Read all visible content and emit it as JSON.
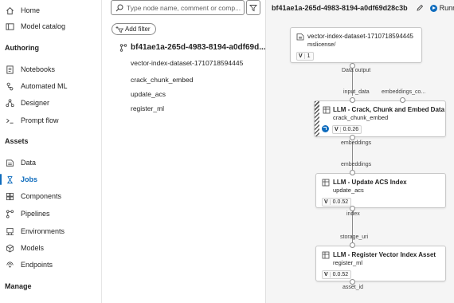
{
  "nav": {
    "items_top": [
      {
        "label": "Home",
        "icon": "home-icon"
      },
      {
        "label": "Model catalog",
        "icon": "model-catalog-icon"
      }
    ],
    "section_authoring": "Authoring",
    "items_authoring": [
      {
        "label": "Notebooks",
        "icon": "notebook-icon"
      },
      {
        "label": "Automated ML",
        "icon": "automated-ml-icon"
      },
      {
        "label": "Designer",
        "icon": "designer-icon"
      },
      {
        "label": "Prompt flow",
        "icon": "prompt-flow-icon"
      }
    ],
    "section_assets": "Assets",
    "items_assets": [
      {
        "label": "Data",
        "icon": "data-icon"
      },
      {
        "label": "Jobs",
        "icon": "jobs-icon",
        "active": true
      },
      {
        "label": "Components",
        "icon": "components-icon"
      },
      {
        "label": "Pipelines",
        "icon": "pipelines-icon"
      },
      {
        "label": "Environments",
        "icon": "environments-icon"
      },
      {
        "label": "Models",
        "icon": "models-icon"
      },
      {
        "label": "Endpoints",
        "icon": "endpoints-icon"
      }
    ],
    "section_manage": "Manage"
  },
  "mid": {
    "search_placeholder": "Type node name, comment or comp...",
    "add_filter_label": "Add filter",
    "job_name": "bf41ae1a-265d-4983-8194-a0df69d...",
    "tree_items": [
      "vector-index-dataset-1710718594445",
      "crack_chunk_embed",
      "update_acs",
      "register_ml"
    ]
  },
  "canvas": {
    "title": "bf41ae1a-265d-4983-8194-a0df69d28c3b",
    "status": "Running",
    "accent": "#0f6cbd",
    "nodes": {
      "dataset": {
        "title": "vector-index-dataset-1710718594445",
        "subtitle": "mslicense/",
        "badge_v": "V",
        "badge_num": "1",
        "output_label": "Data output"
      },
      "crack": {
        "title": "LLM - Crack, Chunk and Embed Data",
        "subtitle": "crack_chunk_embed",
        "badge_v": "V",
        "badge_num": "0.0.26",
        "input1": "input_data",
        "input2": "embeddings_co...",
        "output_label": "embeddings"
      },
      "acs": {
        "title": "LLM - Update ACS Index",
        "subtitle": "update_acs",
        "badge_v": "V",
        "badge_num": "0.0.52",
        "input_label": "embeddings",
        "output_label": "index"
      },
      "register": {
        "title": "LLM - Register Vector Index Asset",
        "subtitle": "register_ml",
        "badge_v": "V",
        "badge_num": "0.0.52",
        "input_label": "storage_uri",
        "output_label": "asset_id"
      }
    }
  }
}
